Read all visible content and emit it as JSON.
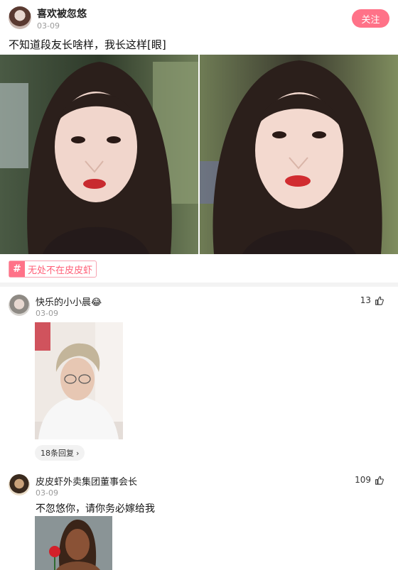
{
  "post": {
    "author": "喜欢被忽悠",
    "date": "03-09",
    "follow_label": "关注",
    "text": "不知道段友长啥样，我长这样[眼]",
    "topic_icon": "#",
    "topic": "无处不在皮皮虾"
  },
  "comments": [
    {
      "author": "快乐的小小晨😂",
      "date": "03-09",
      "likes": "13",
      "replies_label": "18条回复",
      "replies_icon": "›"
    },
    {
      "author": "皮皮虾外卖集团董事会长",
      "date": "03-09",
      "likes": "109",
      "text": "不忽悠你，请你务必嫁给我"
    }
  ],
  "colors": {
    "accent": "#ff7288",
    "tag_text": "#ff5f77"
  }
}
